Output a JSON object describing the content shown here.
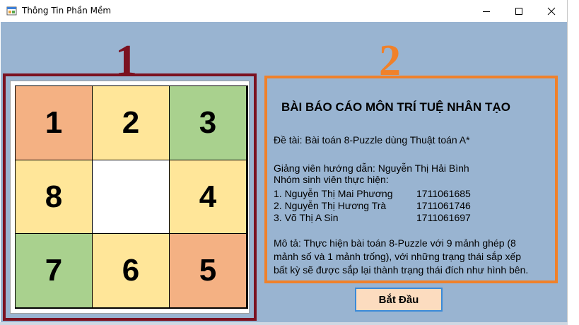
{
  "window": {
    "title": "Thông Tin Phần Mềm",
    "icon": "app-form-icon",
    "controls": [
      "minimize-icon",
      "maximize-icon",
      "close-icon"
    ]
  },
  "markers": {
    "board": "1",
    "info": "2"
  },
  "colors": {
    "client_bg": "#99b4d1",
    "board_border": "#7b1120",
    "info_border": "#f0812a",
    "tile_orange": "#f4b183",
    "tile_yellow": "#ffe699",
    "tile_green": "#a9d18e",
    "tile_empty": "#ffffff",
    "button_bg": "#fcdcbf",
    "button_border": "#3a8ad8"
  },
  "board": {
    "tiles": [
      {
        "label": "1",
        "color": "#f4b183"
      },
      {
        "label": "2",
        "color": "#ffe699"
      },
      {
        "label": "3",
        "color": "#a9d18e"
      },
      {
        "label": "8",
        "color": "#ffe699"
      },
      {
        "label": "",
        "color": "#ffffff"
      },
      {
        "label": "4",
        "color": "#ffe699"
      },
      {
        "label": "7",
        "color": "#a9d18e"
      },
      {
        "label": "6",
        "color": "#ffe699"
      },
      {
        "label": "5",
        "color": "#f4b183"
      }
    ]
  },
  "info": {
    "heading": "BÀI BÁO CÁO MÔN TRÍ TUỆ NHÂN TẠO",
    "topic": "Đề tài: Bài toán 8-Puzzle dùng Thuật toán A*",
    "advisor": "Giảng viên hướng dẫn: Nguyễn Thị Hải Bình",
    "group_label": "Nhóm sinh viên thực hiện:",
    "members": [
      {
        "name": "1. Nguyễn Thị Mai Phương",
        "id": "1711061685"
      },
      {
        "name": "2. Nguyễn Thị Hương Trà",
        "id": "1711061746"
      },
      {
        "name": "3. Võ Thị A Sin",
        "id": "1711061697"
      }
    ],
    "description": [
      "Mô tả: Thực hiện bài toán 8-Puzzle với 9 mảnh ghép (8",
      "mảnh số và 1 mảnh trống), với những trạng thái sắp xếp",
      "bất kỳ sẽ được sắp lại thành trạng thái đích như hình bên."
    ]
  },
  "start_button": {
    "label": "Bắt Đầu"
  }
}
